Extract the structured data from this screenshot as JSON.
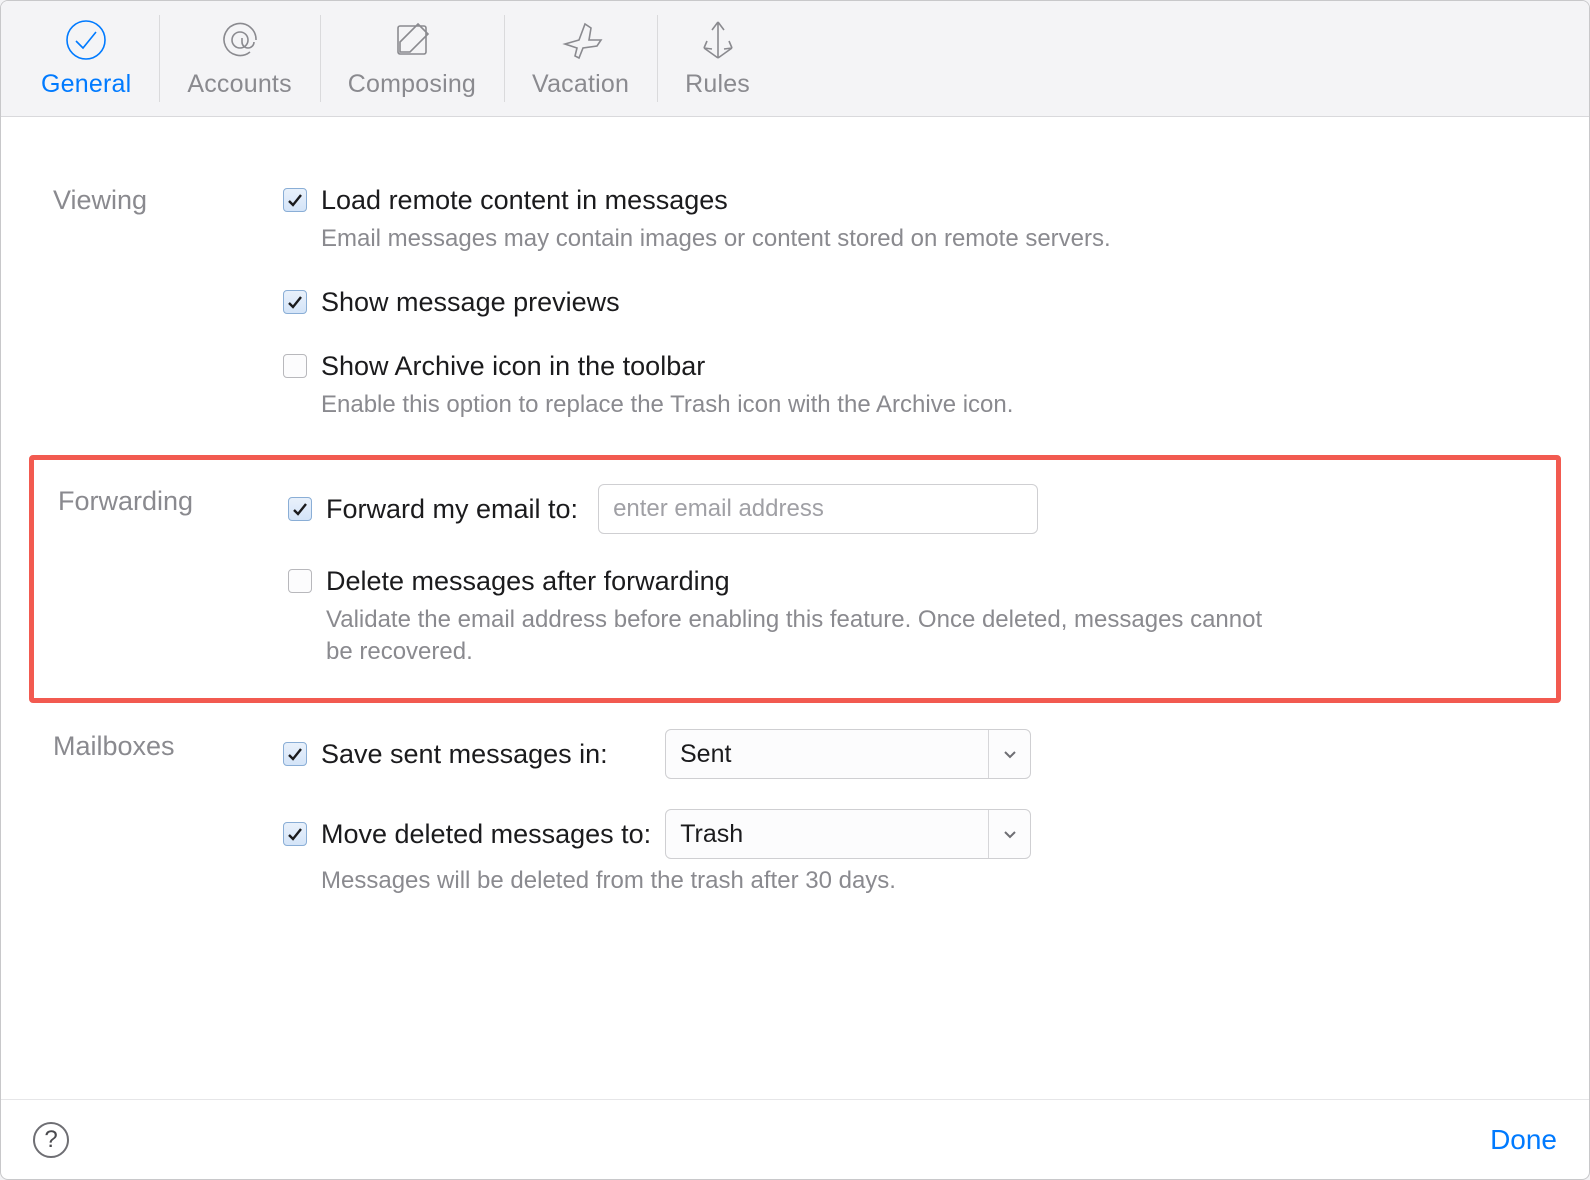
{
  "tabs": {
    "general": {
      "label": "General"
    },
    "accounts": {
      "label": "Accounts"
    },
    "composing": {
      "label": "Composing"
    },
    "vacation": {
      "label": "Vacation"
    },
    "rules": {
      "label": "Rules"
    }
  },
  "sections": {
    "viewing": {
      "title": "Viewing",
      "load_remote": {
        "label": "Load remote content in messages",
        "desc": "Email messages may contain images or content stored on remote servers."
      },
      "previews": {
        "label": "Show message previews"
      },
      "archive_icon": {
        "label": "Show Archive icon in the toolbar",
        "desc": "Enable this option to replace the Trash icon with the Archive icon."
      }
    },
    "forwarding": {
      "title": "Forwarding",
      "forward": {
        "label": "Forward my email to:",
        "placeholder": "enter email address",
        "value": ""
      },
      "delete_after": {
        "label": "Delete messages after forwarding",
        "desc": "Validate the email address before enabling this feature. Once deleted, messages cannot be recovered."
      }
    },
    "mailboxes": {
      "title": "Mailboxes",
      "save_sent": {
        "label": "Save sent messages in:",
        "value": "Sent"
      },
      "move_deleted": {
        "label": "Move deleted messages to:",
        "value": "Trash"
      },
      "retention_desc": "Messages will be deleted from the trash after 30 days."
    }
  },
  "footer": {
    "done": "Done"
  }
}
